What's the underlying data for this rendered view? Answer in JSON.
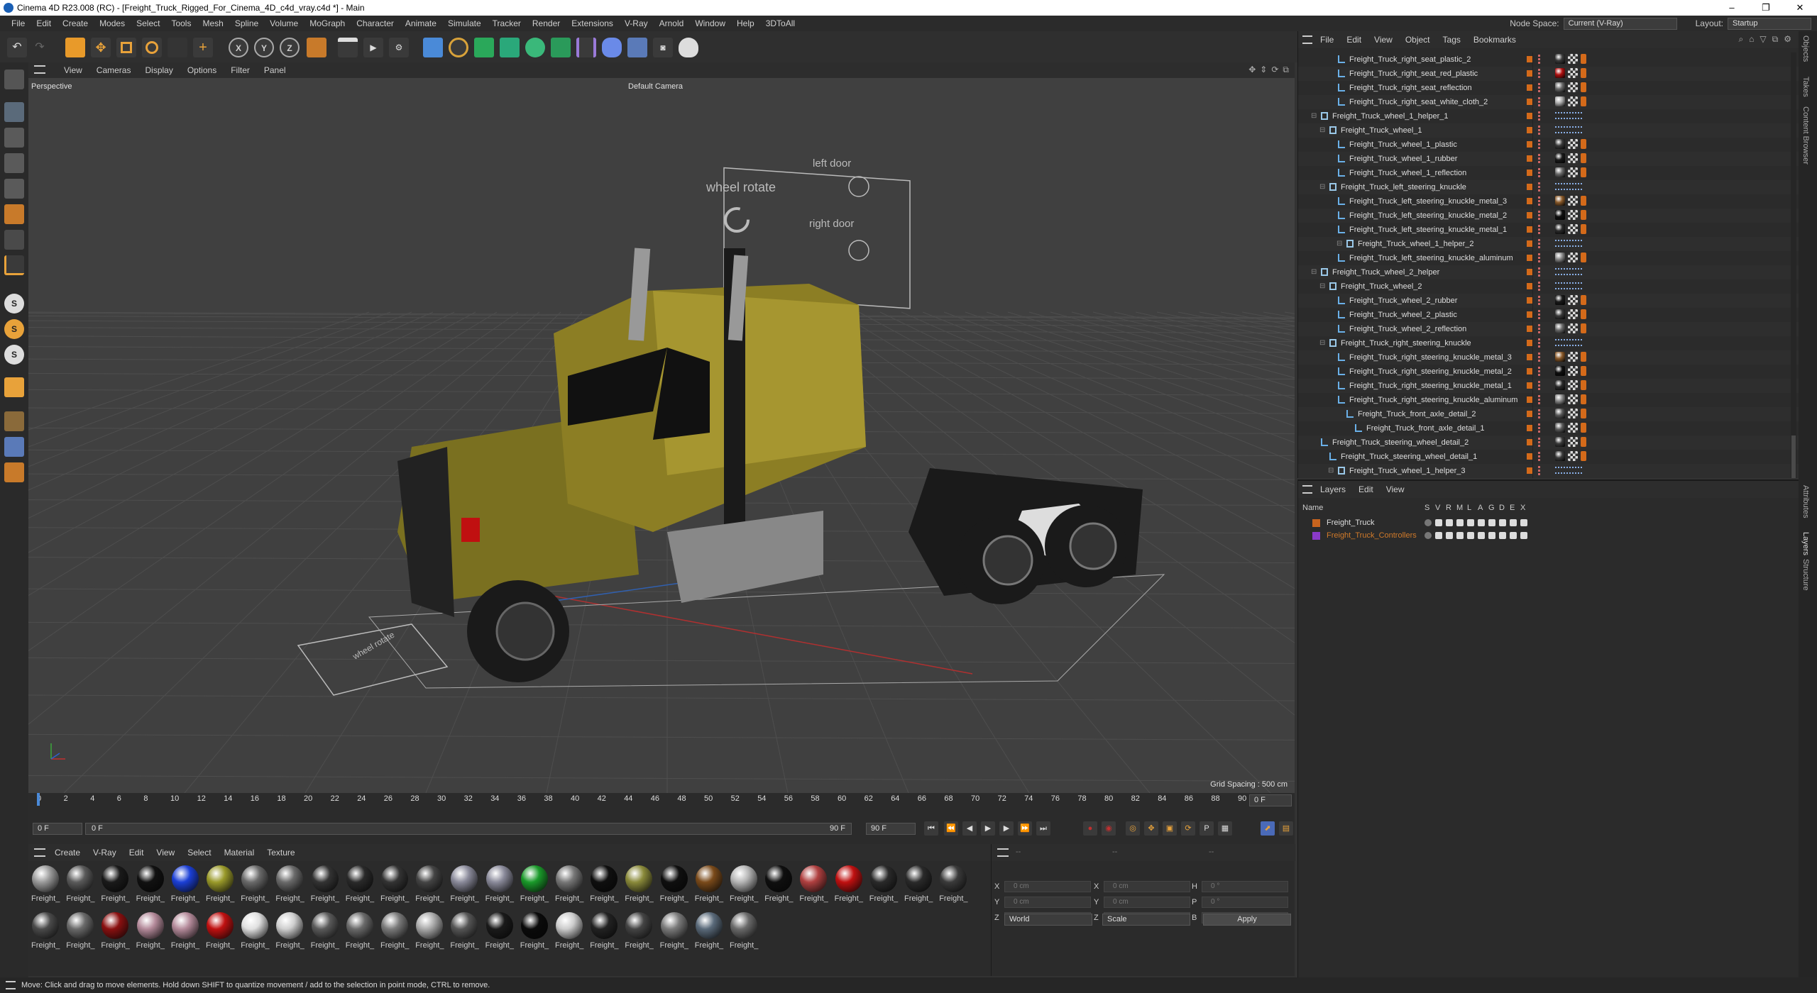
{
  "window": {
    "title": "Cinema 4D R23.008 (RC) - [Freight_Truck_Rigged_For_Cinema_4D_c4d_vray.c4d *] - Main",
    "controls": [
      "–",
      "❐",
      "✕"
    ]
  },
  "menubar": {
    "items": [
      "File",
      "Edit",
      "Create",
      "Modes",
      "Select",
      "Tools",
      "Mesh",
      "Spline",
      "Volume",
      "MoGraph",
      "Character",
      "Animate",
      "Simulate",
      "Tracker",
      "Render",
      "Extensions",
      "V-Ray",
      "Arnold",
      "Window",
      "Help",
      "3DToAll"
    ],
    "node_space_label": "Node Space:",
    "node_space_value": "Current (V-Ray)",
    "layout_label": "Layout:",
    "layout_value": "Startup"
  },
  "viewport": {
    "menu": [
      "View",
      "Cameras",
      "Display",
      "Options",
      "Filter",
      "Panel"
    ],
    "mode_label": "Perspective",
    "camera_label": "Default Camera",
    "grid_spacing": "Grid Spacing : 500 cm",
    "controller_text": {
      "wheel_rotate": "wheel rotate",
      "left_door": "left door",
      "right_door": "right door",
      "wheel_rotate_small": "wheel rotate"
    }
  },
  "timeline": {
    "ticks": [
      "0",
      "2",
      "4",
      "6",
      "8",
      "10",
      "12",
      "14",
      "16",
      "18",
      "20",
      "22",
      "24",
      "26",
      "28",
      "30",
      "32",
      "34",
      "36",
      "38",
      "40",
      "42",
      "44",
      "46",
      "48",
      "50",
      "52",
      "54",
      "56",
      "58",
      "60",
      "62",
      "64",
      "66",
      "68",
      "70",
      "72",
      "74",
      "76",
      "78",
      "80",
      "82",
      "84",
      "86",
      "88",
      "90"
    ],
    "current_frame_right": "0 F",
    "start_field": "0 F",
    "range_start": "0 F",
    "range_end_inner": "90 F",
    "range_end": "90 F"
  },
  "materials": {
    "menu": [
      "Create",
      "V-Ray",
      "Edit",
      "View",
      "Select",
      "Material",
      "Texture"
    ],
    "label": "Freight_",
    "row1": [
      "#9a9a9a",
      "#5a5a5a",
      "#1a1a1a",
      "#111111",
      "#1b3fd6",
      "#9a9a2a",
      "#6a6a6a",
      "#6a6a6a",
      "#333333",
      "#2a2a2a",
      "#333333",
      "#444444",
      "#8a8a9a",
      "#8a8a9a",
      "#1a9a2a",
      "#777777",
      "#0f0f0f",
      "#8a8a3a",
      "#0f0f0f",
      "#7a4a1a",
      "#b5b5b5",
      "#0f0f0f",
      "#b04040",
      "#c01010",
      "#2a2a2a",
      "#2a2a2a",
      "#3a3a3a"
    ],
    "row2": [
      "#4a4a4a",
      "#6a6a6a",
      "#8a1010",
      "#b48a9a",
      "#b48a9a",
      "#c01010",
      "#e0e0e0",
      "#cfcfcf",
      "#5a5a5a",
      "#6a6a6a",
      "#7a7a7a",
      "#aaaaaa",
      "#555555",
      "#1a1a1a",
      "#0a0a0a",
      "#cccccc",
      "#222222",
      "#444444",
      "#7a7a7a",
      "#5a6a7a",
      "#6a6a6a"
    ]
  },
  "coordinates": {
    "rows": [
      {
        "a": "X",
        "av": "0 cm",
        "b": "X",
        "bv": "0 cm",
        "c": "H",
        "cv": "0 °"
      },
      {
        "a": "Y",
        "av": "0 cm",
        "b": "Y",
        "bv": "0 cm",
        "c": "P",
        "cv": "0 °"
      },
      {
        "a": "Z",
        "av": "0 cm",
        "b": "Z",
        "bv": "0 cm",
        "c": "B",
        "cv": "0 °"
      }
    ],
    "header_dashes": [
      "--",
      "--",
      "--"
    ],
    "space_dropdown": "World",
    "mode_dropdown": "Scale",
    "apply_label": "Apply"
  },
  "object_manager": {
    "menu": [
      "File",
      "Edit",
      "View",
      "Object",
      "Tags",
      "Bookmarks"
    ],
    "rows": [
      {
        "name": "Freight_Truck_right_seat_plastic_2",
        "indent": 3,
        "mat": "#3a3a3a"
      },
      {
        "name": "Freight_Truck_right_seat_red_plastic",
        "indent": 3,
        "mat": "#b01010"
      },
      {
        "name": "Freight_Truck_right_seat_reflection",
        "indent": 3,
        "mat": "#6a6a6a"
      },
      {
        "name": "Freight_Truck_right_seat_white_cloth_2",
        "indent": 3,
        "mat": "#aaaaaa"
      },
      {
        "name": "Freight_Truck_wheel_1_helper_1",
        "indent": 1,
        "mat": ""
      },
      {
        "name": "Freight_Truck_wheel_1",
        "indent": 2,
        "mat": ""
      },
      {
        "name": "Freight_Truck_wheel_1_plastic",
        "indent": 3,
        "mat": "#3a3a3a"
      },
      {
        "name": "Freight_Truck_wheel_1_rubber",
        "indent": 3,
        "mat": "#1a1a1a"
      },
      {
        "name": "Freight_Truck_wheel_1_reflection",
        "indent": 3,
        "mat": "#6a6a6a"
      },
      {
        "name": "Freight_Truck_left_steering_knuckle",
        "indent": 2,
        "mat": ""
      },
      {
        "name": "Freight_Truck_left_steering_knuckle_metal_3",
        "indent": 3,
        "mat": "#8a5a2a"
      },
      {
        "name": "Freight_Truck_left_steering_knuckle_metal_2",
        "indent": 3,
        "mat": "#0f0f0f"
      },
      {
        "name": "Freight_Truck_left_steering_knuckle_metal_1",
        "indent": 3,
        "mat": "#2a2a2a"
      },
      {
        "name": "Freight_Truck_wheel_1_helper_2",
        "indent": 4,
        "mat": ""
      },
      {
        "name": "Freight_Truck_left_steering_knuckle_aluminum",
        "indent": 3,
        "mat": "#8a8a8a"
      },
      {
        "name": "Freight_Truck_wheel_2_helper",
        "indent": 1,
        "mat": ""
      },
      {
        "name": "Freight_Truck_wheel_2",
        "indent": 2,
        "mat": ""
      },
      {
        "name": "Freight_Truck_wheel_2_rubber",
        "indent": 3,
        "mat": "#1a1a1a"
      },
      {
        "name": "Freight_Truck_wheel_2_plastic",
        "indent": 3,
        "mat": "#3a3a3a"
      },
      {
        "name": "Freight_Truck_wheel_2_reflection",
        "indent": 3,
        "mat": "#6a6a6a"
      },
      {
        "name": "Freight_Truck_right_steering_knuckle",
        "indent": 2,
        "mat": ""
      },
      {
        "name": "Freight_Truck_right_steering_knuckle_metal_3",
        "indent": 3,
        "mat": "#8a5a2a"
      },
      {
        "name": "Freight_Truck_right_steering_knuckle_metal_2",
        "indent": 3,
        "mat": "#0f0f0f"
      },
      {
        "name": "Freight_Truck_right_steering_knuckle_metal_1",
        "indent": 3,
        "mat": "#2a2a2a"
      },
      {
        "name": "Freight_Truck_right_steering_knuckle_aluminum",
        "indent": 3,
        "mat": "#8a8a8a"
      },
      {
        "name": "Freight_Truck_front_axle_detail_2",
        "indent": 4,
        "mat": "#5a5a5a"
      },
      {
        "name": "Freight_Truck_front_axle_detail_1",
        "indent": 5,
        "mat": "#5a5a5a"
      },
      {
        "name": "Freight_Truck_steering_wheel_detail_2",
        "indent": 1,
        "mat": "#3a3a3a"
      },
      {
        "name": "Freight_Truck_steering_wheel_detail_1",
        "indent": 2,
        "mat": "#3a3a3a"
      },
      {
        "name": "Freight_Truck_wheel_1_helper_3",
        "indent": 3,
        "mat": ""
      }
    ]
  },
  "layers": {
    "menu": [
      "Layers",
      "Edit",
      "View"
    ],
    "columns": [
      "Name",
      "S",
      "V",
      "R",
      "M",
      "L",
      "A",
      "G",
      "D",
      "E",
      "X"
    ],
    "rows": [
      {
        "name": "Freight_Truck",
        "color": "#c8641e",
        "text_color": "#dddddd"
      },
      {
        "name": "Freight_Truck_Controllers",
        "color": "#8a3ac8",
        "text_color": "#d07a2a"
      }
    ]
  },
  "side_tabs": [
    "Objects",
    "Takes",
    "Content Browser",
    "Attributes",
    "Layers",
    "Structure"
  ],
  "status": "Move: Click and drag to move elements. Hold down SHIFT to quantize movement / add to the selection in point mode, CTRL to remove."
}
